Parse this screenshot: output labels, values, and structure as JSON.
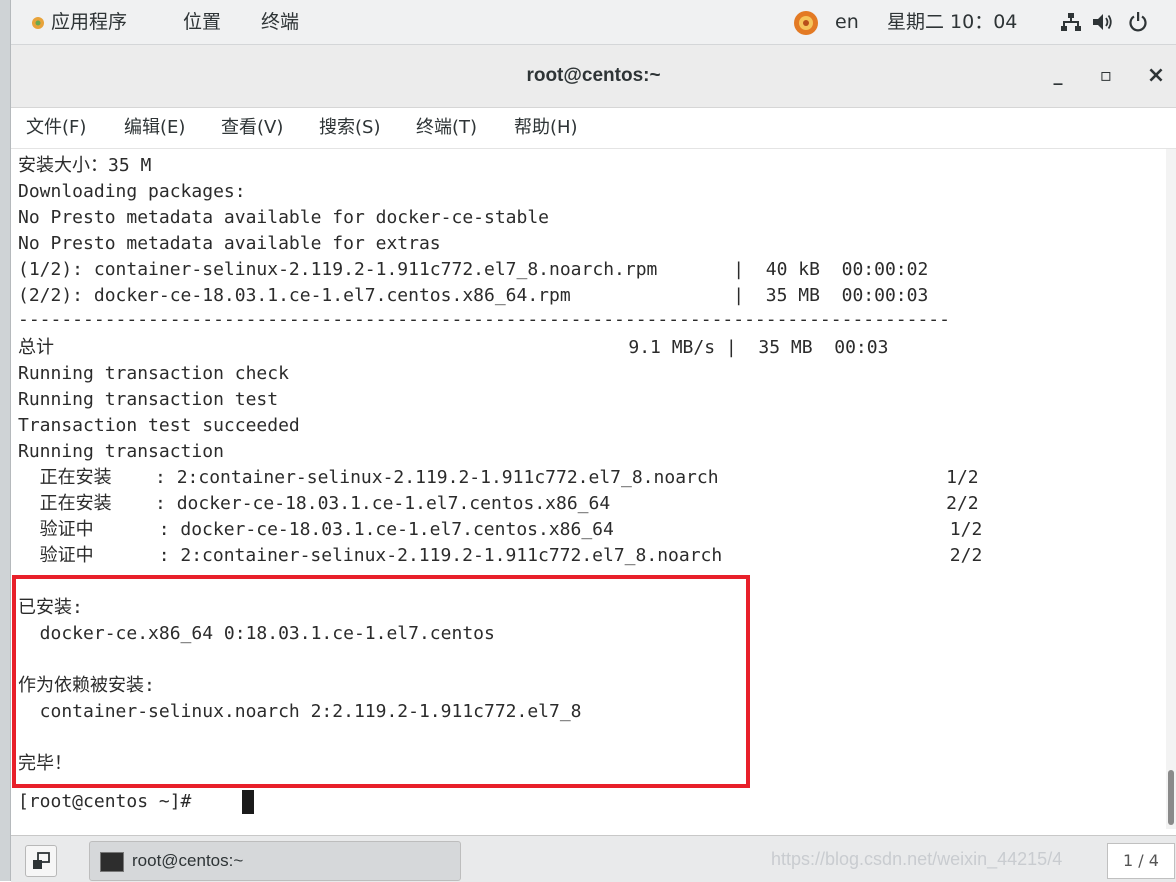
{
  "top_bar": {
    "applications": "应用程序",
    "places": "位置",
    "terminal": "终端",
    "input_method": "en",
    "datetime": "星期二 10：04",
    "network_icon": "network-icon",
    "volume_icon": "volume-icon",
    "power_icon": "power-icon"
  },
  "window": {
    "title": "root@centos:~",
    "minimize": "_",
    "maximize": "▫",
    "close": "×"
  },
  "menu": {
    "file": "文件(F)",
    "edit": "编辑(E)",
    "view": "查看(V)",
    "search": "搜索(S)",
    "terminal": "终端(T)",
    "help": "帮助(H)"
  },
  "terminal": {
    "lines": [
      "安装大小：35 M",
      "Downloading packages:",
      "No Presto metadata available for docker-ce-stable",
      "No Presto metadata available for extras",
      "(1/2): container-selinux-2.119.2-1.911c772.el7_8.noarch.rpm       |  40 kB  00:00:02",
      "(2/2): docker-ce-18.03.1.ce-1.el7.centos.x86_64.rpm               |  35 MB  00:00:03",
      "--------------------------------------------------------------------------------------",
      "总计                                                     9.1 MB/s |  35 MB  00:03",
      "Running transaction check",
      "Running transaction test",
      "Transaction test succeeded",
      "Running transaction",
      "  正在安装    : 2:container-selinux-2.119.2-1.911c772.el7_8.noarch                     1/2",
      "  正在安装    : docker-ce-18.03.1.ce-1.el7.centos.x86_64                               2/2",
      "  验证中      : docker-ce-18.03.1.ce-1.el7.centos.x86_64                               1/2",
      "  验证中      : 2:container-selinux-2.119.2-1.911c772.el7_8.noarch                     2/2",
      "",
      "已安装:",
      "  docker-ce.x86_64 0:18.03.1.ce-1.el7.centos",
      "",
      "作为依赖被安装:",
      "  container-selinux.noarch 2:2.119.2-1.911c772.el7_8",
      "",
      "完毕！",
      "[root@centos ~]# "
    ]
  },
  "taskbar": {
    "window_label": "root@centos:~",
    "watermark": "https://blog.csdn.net/weixin_44215/4",
    "pager": "1 / 4"
  },
  "colors": {
    "highlight": "#e8202a",
    "terminal_text": "#2b2b2b"
  }
}
